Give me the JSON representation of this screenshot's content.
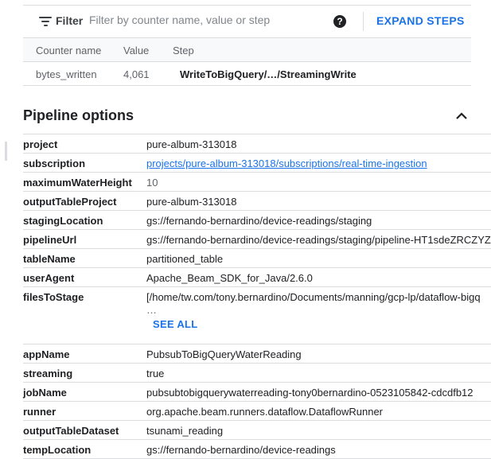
{
  "counters": {
    "filter_label": "Filter",
    "filter_placeholder": "Filter by counter name, value or step",
    "expand_label": "EXPAND STEPS",
    "columns": [
      "Counter name",
      "Value",
      "Step"
    ],
    "rows": [
      {
        "name": "bytes_written",
        "value": "4,061",
        "step": "WriteToBigQuery/…/StreamingWrite"
      }
    ]
  },
  "pipeline": {
    "title": "Pipeline options",
    "options": [
      {
        "key": "project",
        "value": "pure-album-313018"
      },
      {
        "key": "subscription",
        "value": "projects/pure-album-313018/subscriptions/real-time-ingestion"
      },
      {
        "key": "maximumWaterHeight",
        "value": "10"
      },
      {
        "key": "outputTableProject",
        "value": "pure-album-313018"
      },
      {
        "key": "stagingLocation",
        "value": "gs://fernando-bernardino/device-readings/staging"
      },
      {
        "key": "pipelineUrl",
        "value": "gs://fernando-bernardino/device-readings/staging/pipeline-HT1sdeZRCZYZ"
      },
      {
        "key": "tableName",
        "value": "partitioned_table"
      },
      {
        "key": "userAgent",
        "value": "Apache_Beam_SDK_for_Java/2.6.0"
      },
      {
        "key": "filesToStage",
        "value": "[/home/tw.com/tony.bernardino/Documents/manning/gcp-lp/dataflow-bigq",
        "ellipsis": "…",
        "see_all": "SEE ALL"
      },
      {
        "key": "appName",
        "value": "PubsubToBigQueryWaterReading"
      },
      {
        "key": "streaming",
        "value": "true"
      },
      {
        "key": "jobName",
        "value": "pubsubtobigquerywaterreading-tony0bernardino-0523105842-cdcdfb12"
      },
      {
        "key": "runner",
        "value": "org.apache.beam.runners.dataflow.DataflowRunner"
      },
      {
        "key": "outputTableDataset",
        "value": "tsunami_reading"
      },
      {
        "key": "tempLocation",
        "value": "gs://fernando-bernardino/device-readings"
      }
    ]
  }
}
